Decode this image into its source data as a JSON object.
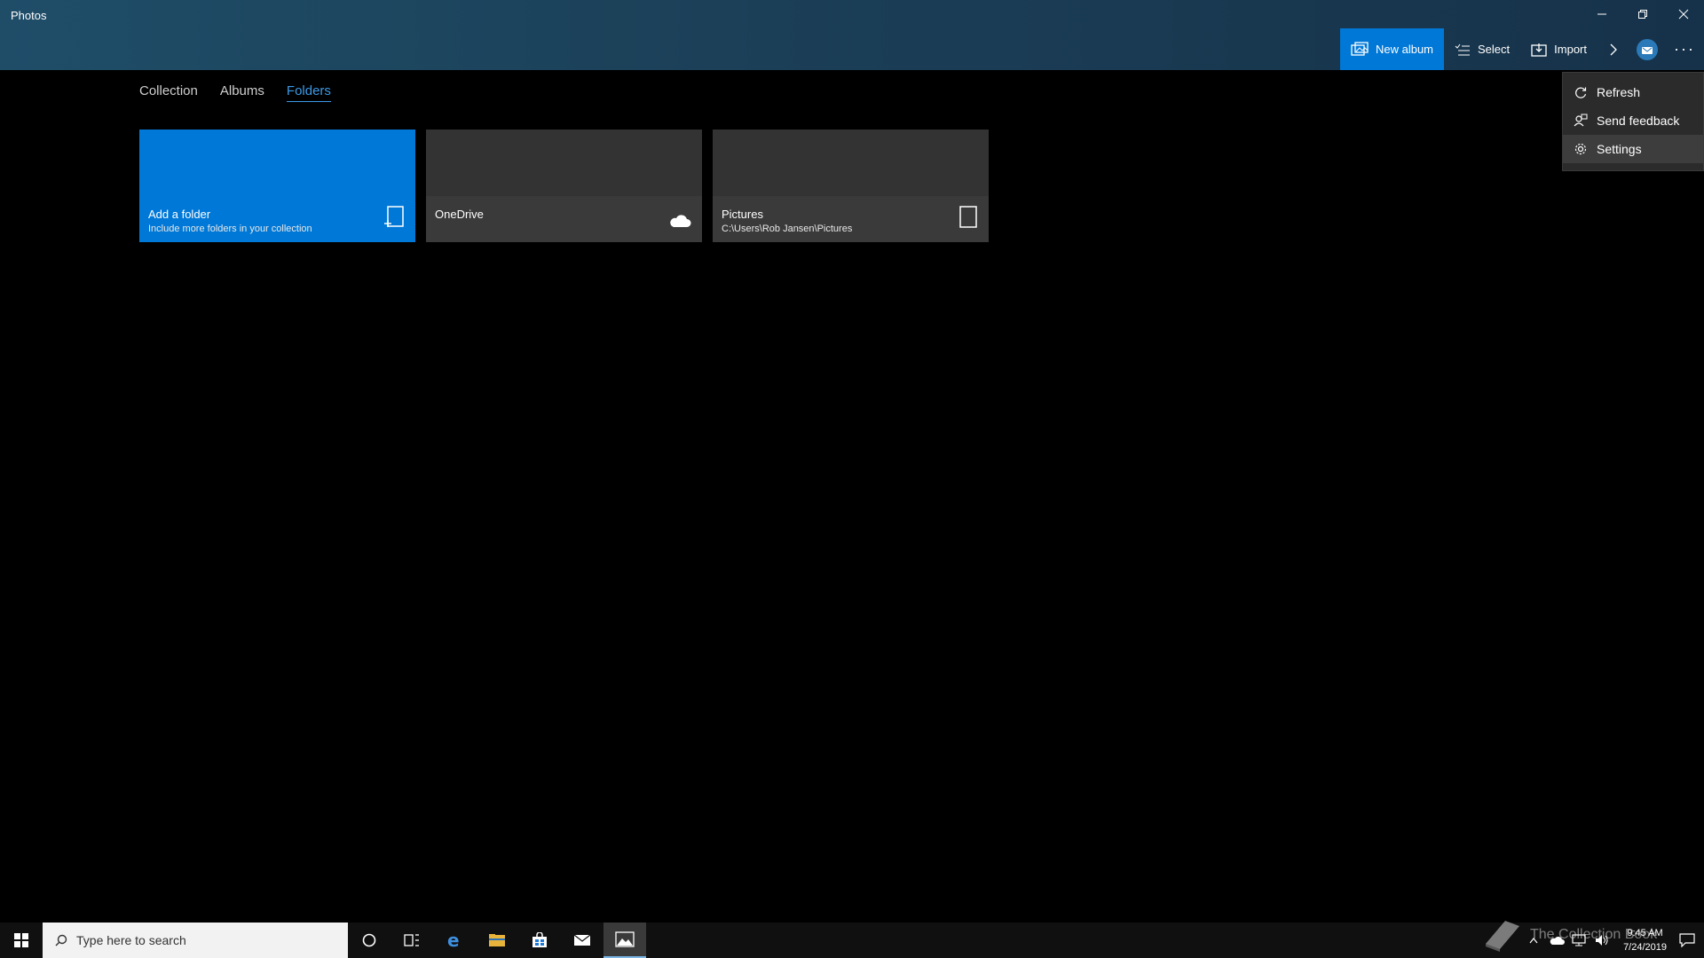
{
  "window": {
    "title": "Photos"
  },
  "commands": {
    "new_album": "New album",
    "select": "Select",
    "import": "Import"
  },
  "menu": {
    "items": [
      {
        "label": "Refresh",
        "icon": "refresh-icon"
      },
      {
        "label": "Send feedback",
        "icon": "feedback-icon"
      },
      {
        "label": "Settings",
        "icon": "gear-icon"
      }
    ]
  },
  "tabs": [
    {
      "label": "Collection",
      "active": false
    },
    {
      "label": "Albums",
      "active": false
    },
    {
      "label": "Folders",
      "active": true
    }
  ],
  "tiles": [
    {
      "title": "Add a folder",
      "subtitle": "Include more folders in your collection",
      "icon": "add-folder-icon",
      "accent": "#0078d7"
    },
    {
      "title": "OneDrive",
      "subtitle": "",
      "icon": "cloud-icon"
    },
    {
      "title": "Pictures",
      "subtitle": "C:\\Users\\Rob Jansen\\Pictures",
      "icon": "folder-icon"
    }
  ],
  "taskbar": {
    "search_placeholder": "Type here to search",
    "time": "9:45 AM",
    "date": "7/24/2019",
    "watermark": "The Collection Book"
  },
  "colors": {
    "accent": "#0078d7",
    "active_tab": "#3b9ae8",
    "background": "#000000"
  }
}
